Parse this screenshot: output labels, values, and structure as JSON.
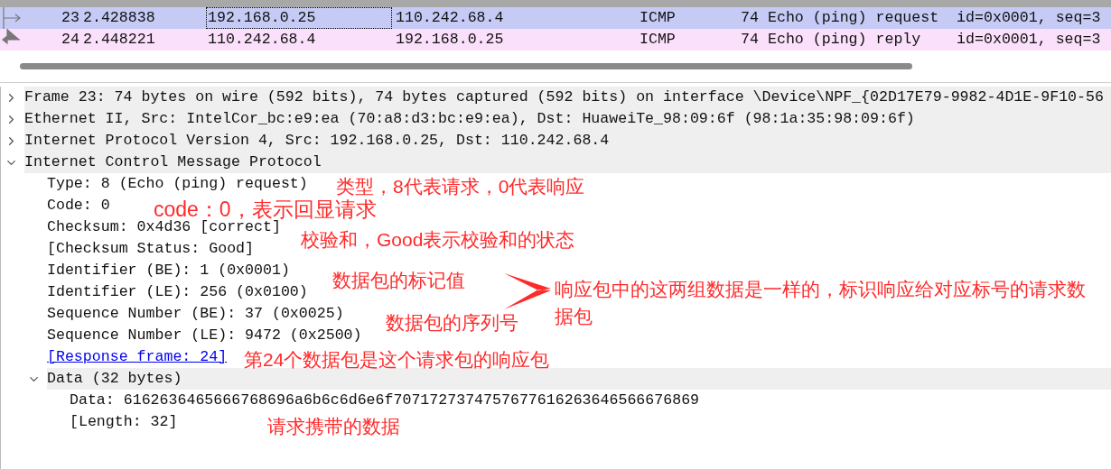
{
  "packets": [
    {
      "no": "23",
      "time": "2.428838",
      "source": "192.168.0.25",
      "destination": "110.242.68.4",
      "protocol": "ICMP",
      "length": "74",
      "info": "Echo (ping) request  id=0x0001, seq=3",
      "kind": "request",
      "selected": true
    },
    {
      "no": "24",
      "time": "2.448221",
      "source": "110.242.68.4",
      "destination": "192.168.0.25",
      "protocol": "ICMP",
      "length": "74",
      "info": "Echo (ping) reply    id=0x0001, seq=3",
      "kind": "response",
      "selected": false
    }
  ],
  "tree": [
    {
      "label": "Frame 23: 74 bytes on wire (592 bits), 74 bytes captured (592 bits) on interface \\Device\\NPF_{02D17E79-9982-4D1E-9F10-56",
      "expanded": false
    },
    {
      "label": "Ethernet II, Src: IntelCor_bc:e9:ea (70:a8:d3:bc:e9:ea), Dst: HuaweiTe_98:09:6f (98:1a:35:98:09:6f)",
      "expanded": false
    },
    {
      "label": "Internet Protocol Version 4, Src: 192.168.0.25, Dst: 110.242.68.4",
      "expanded": false
    },
    {
      "label": "Internet Control Message Protocol",
      "expanded": true,
      "children": [
        {
          "label": "Type: 8 (Echo (ping) request)"
        },
        {
          "label": "Code: 0"
        },
        {
          "label": "Checksum: 0x4d36 [correct]"
        },
        {
          "label": "[Checksum Status: Good]"
        },
        {
          "label": "Identifier (BE): 1 (0x0001)"
        },
        {
          "label": "Identifier (LE): 256 (0x0100)"
        },
        {
          "label": "Sequence Number (BE): 37 (0x0025)"
        },
        {
          "label": "Sequence Number (LE): 9472 (0x2500)"
        },
        {
          "label": "[Response frame: 24]",
          "kind": "link"
        },
        {
          "label": "Data (32 bytes)",
          "expanded": true,
          "children": [
            {
              "label": "Data: 6162636465666768696a6b6c6d6e6f7071727374757677616263646566676869"
            },
            {
              "label": "[Length: 32]"
            }
          ]
        }
      ]
    }
  ],
  "annotations": [
    "类型，8代表请求，0代表响应",
    "code：0，表示回显请求",
    "校验和，Good表示校验和的状态",
    "数据包的标记值",
    "数据包的序列号",
    "第24个数据包是这个请求包的响应包",
    "响应包中的这两组数据是一样的，标识响应给对应标号的请求数据包",
    "请求携带的数据"
  ]
}
